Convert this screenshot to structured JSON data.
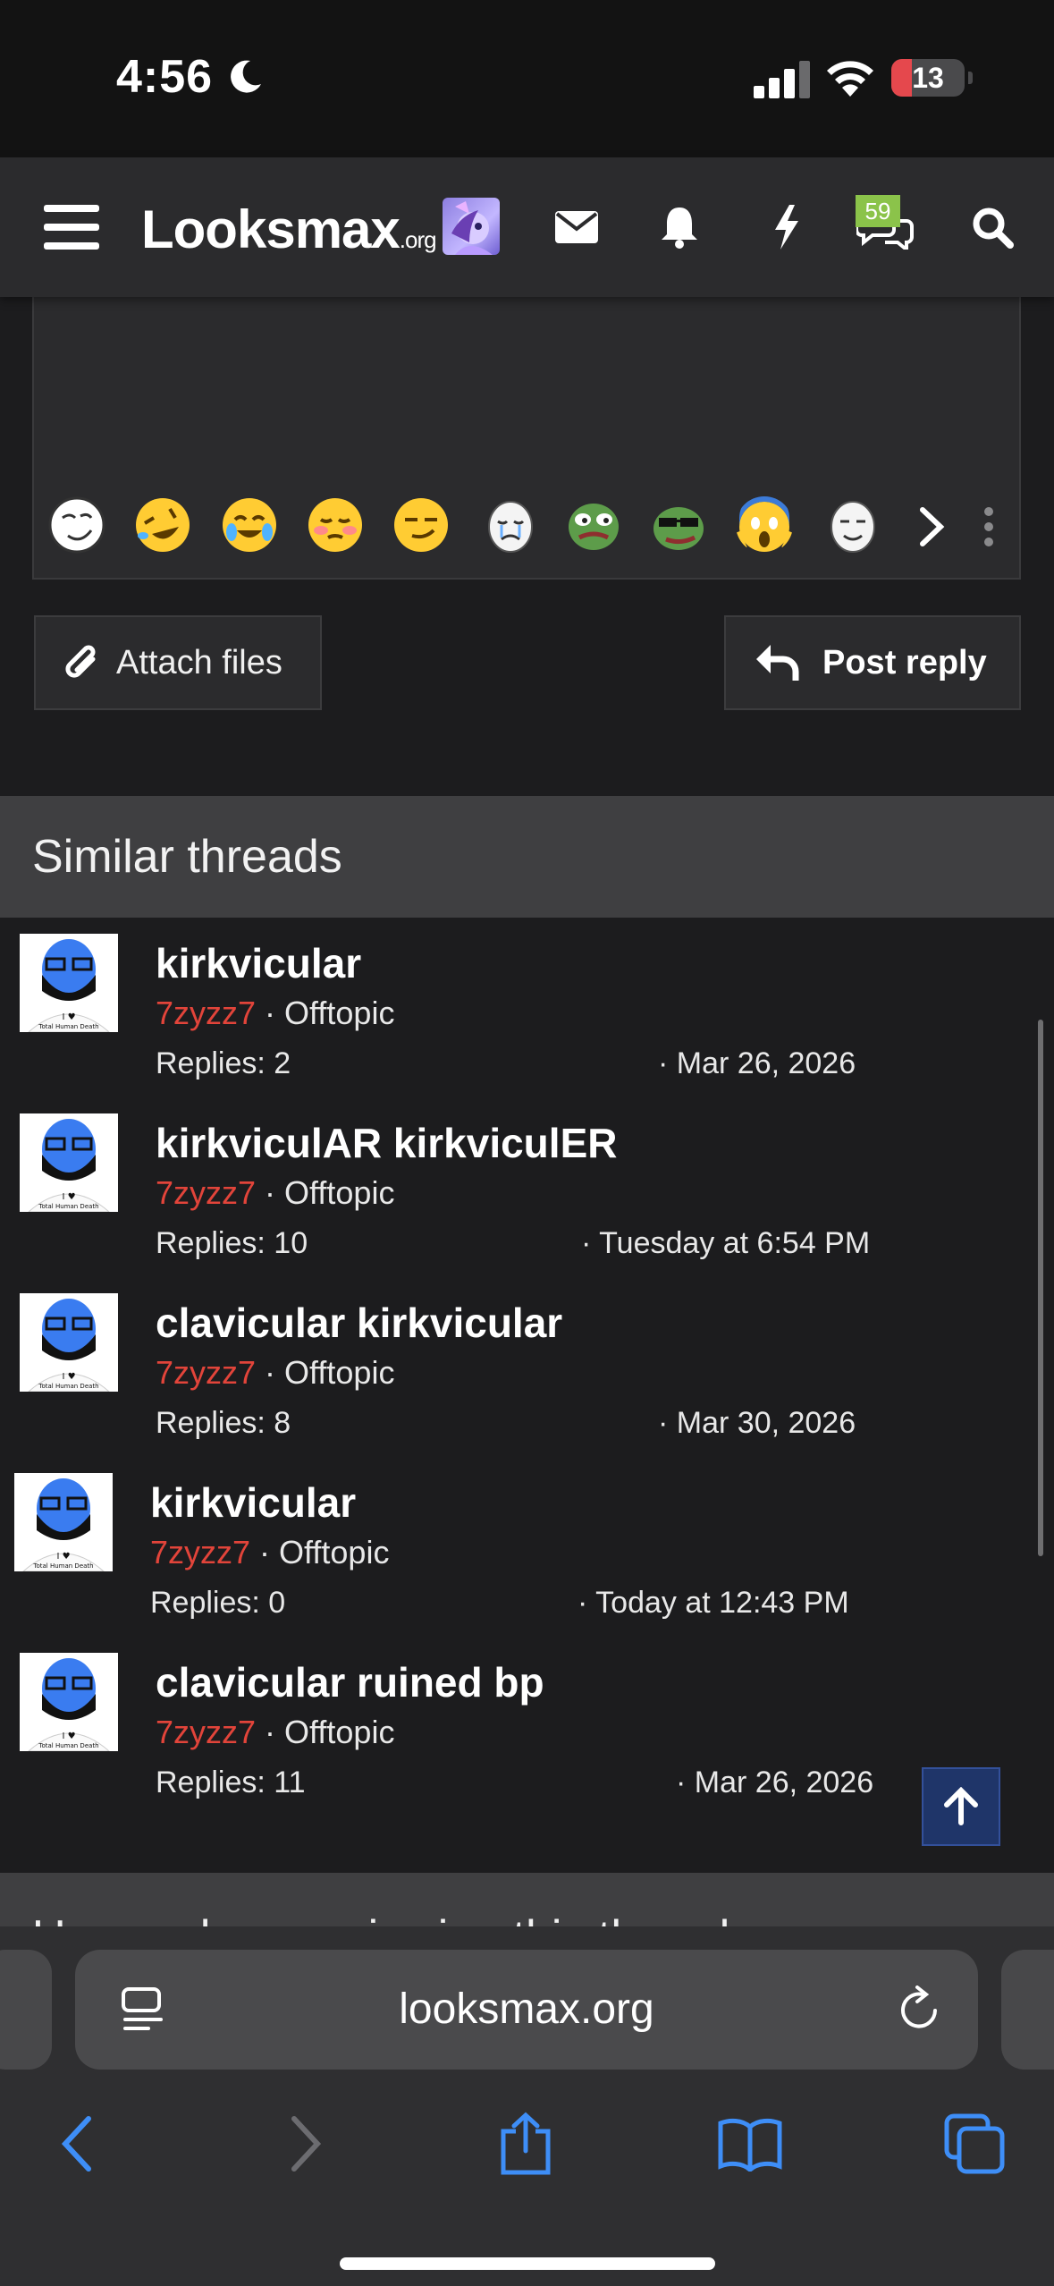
{
  "status_bar": {
    "time": "4:56",
    "battery_level": "13",
    "icons": [
      "moon-icon",
      "cellular-signal-icon",
      "wifi-icon",
      "battery-icon"
    ]
  },
  "header": {
    "logo_text": "Looksmax",
    "logo_suffix": ".org",
    "conversations_badge": "59",
    "icons": [
      "menu-icon",
      "user-avatar",
      "envelope-icon",
      "bell-icon",
      "bolt-icon",
      "chat-bubbles-icon",
      "search-icon"
    ]
  },
  "editor": {
    "emojis": [
      "smug-face",
      "rofl",
      "joy-crying",
      "blushing-smile",
      "smirk",
      "wojak-cry",
      "pepe-sad",
      "pepe-sunglasses",
      "scream",
      "wojak-smile"
    ],
    "attach_label": "Attach files",
    "reply_label": "Post reply"
  },
  "similar_threads": {
    "heading": "Similar threads",
    "threads": [
      {
        "title": "kirkvicular",
        "author": "7zyzz7",
        "forum": "Offtopic",
        "replies": "Replies: 2",
        "date": "Mar 26, 2026"
      },
      {
        "title": "kirkviculAR kirkviculER",
        "author": "7zyzz7",
        "forum": "Offtopic",
        "replies": "Replies: 10",
        "date": "Tuesday at 6:54 PM"
      },
      {
        "title": "clavicular kirkvicular",
        "author": "7zyzz7",
        "forum": "Offtopic",
        "replies": "Replies: 8",
        "date": "Mar 30, 2026"
      },
      {
        "title": "kirkvicular",
        "author": "7zyzz7",
        "forum": "Offtopic",
        "replies": "Replies: 0",
        "date": "Today at 12:43 PM"
      },
      {
        "title": "clavicular ruined bp",
        "author": "7zyzz7",
        "forum": "Offtopic",
        "replies": "Replies: 11",
        "date": "Mar 26, 2026"
      }
    ],
    "avatar_caption": "Total Human Death"
  },
  "next_section_heading": "Users who are viewing this thread",
  "safari": {
    "url": "looksmax.org",
    "nav_icons": [
      "back-icon",
      "forward-icon",
      "share-icon",
      "bookmarks-icon",
      "tabs-icon"
    ]
  },
  "colors": {
    "background": "#1c1c1e",
    "header_bg": "#2b2b2d",
    "section_bg": "#3f3f41",
    "username_red": "#e2443a",
    "badge_green": "#8bc34a",
    "safari_blue": "#3e8ef7"
  }
}
